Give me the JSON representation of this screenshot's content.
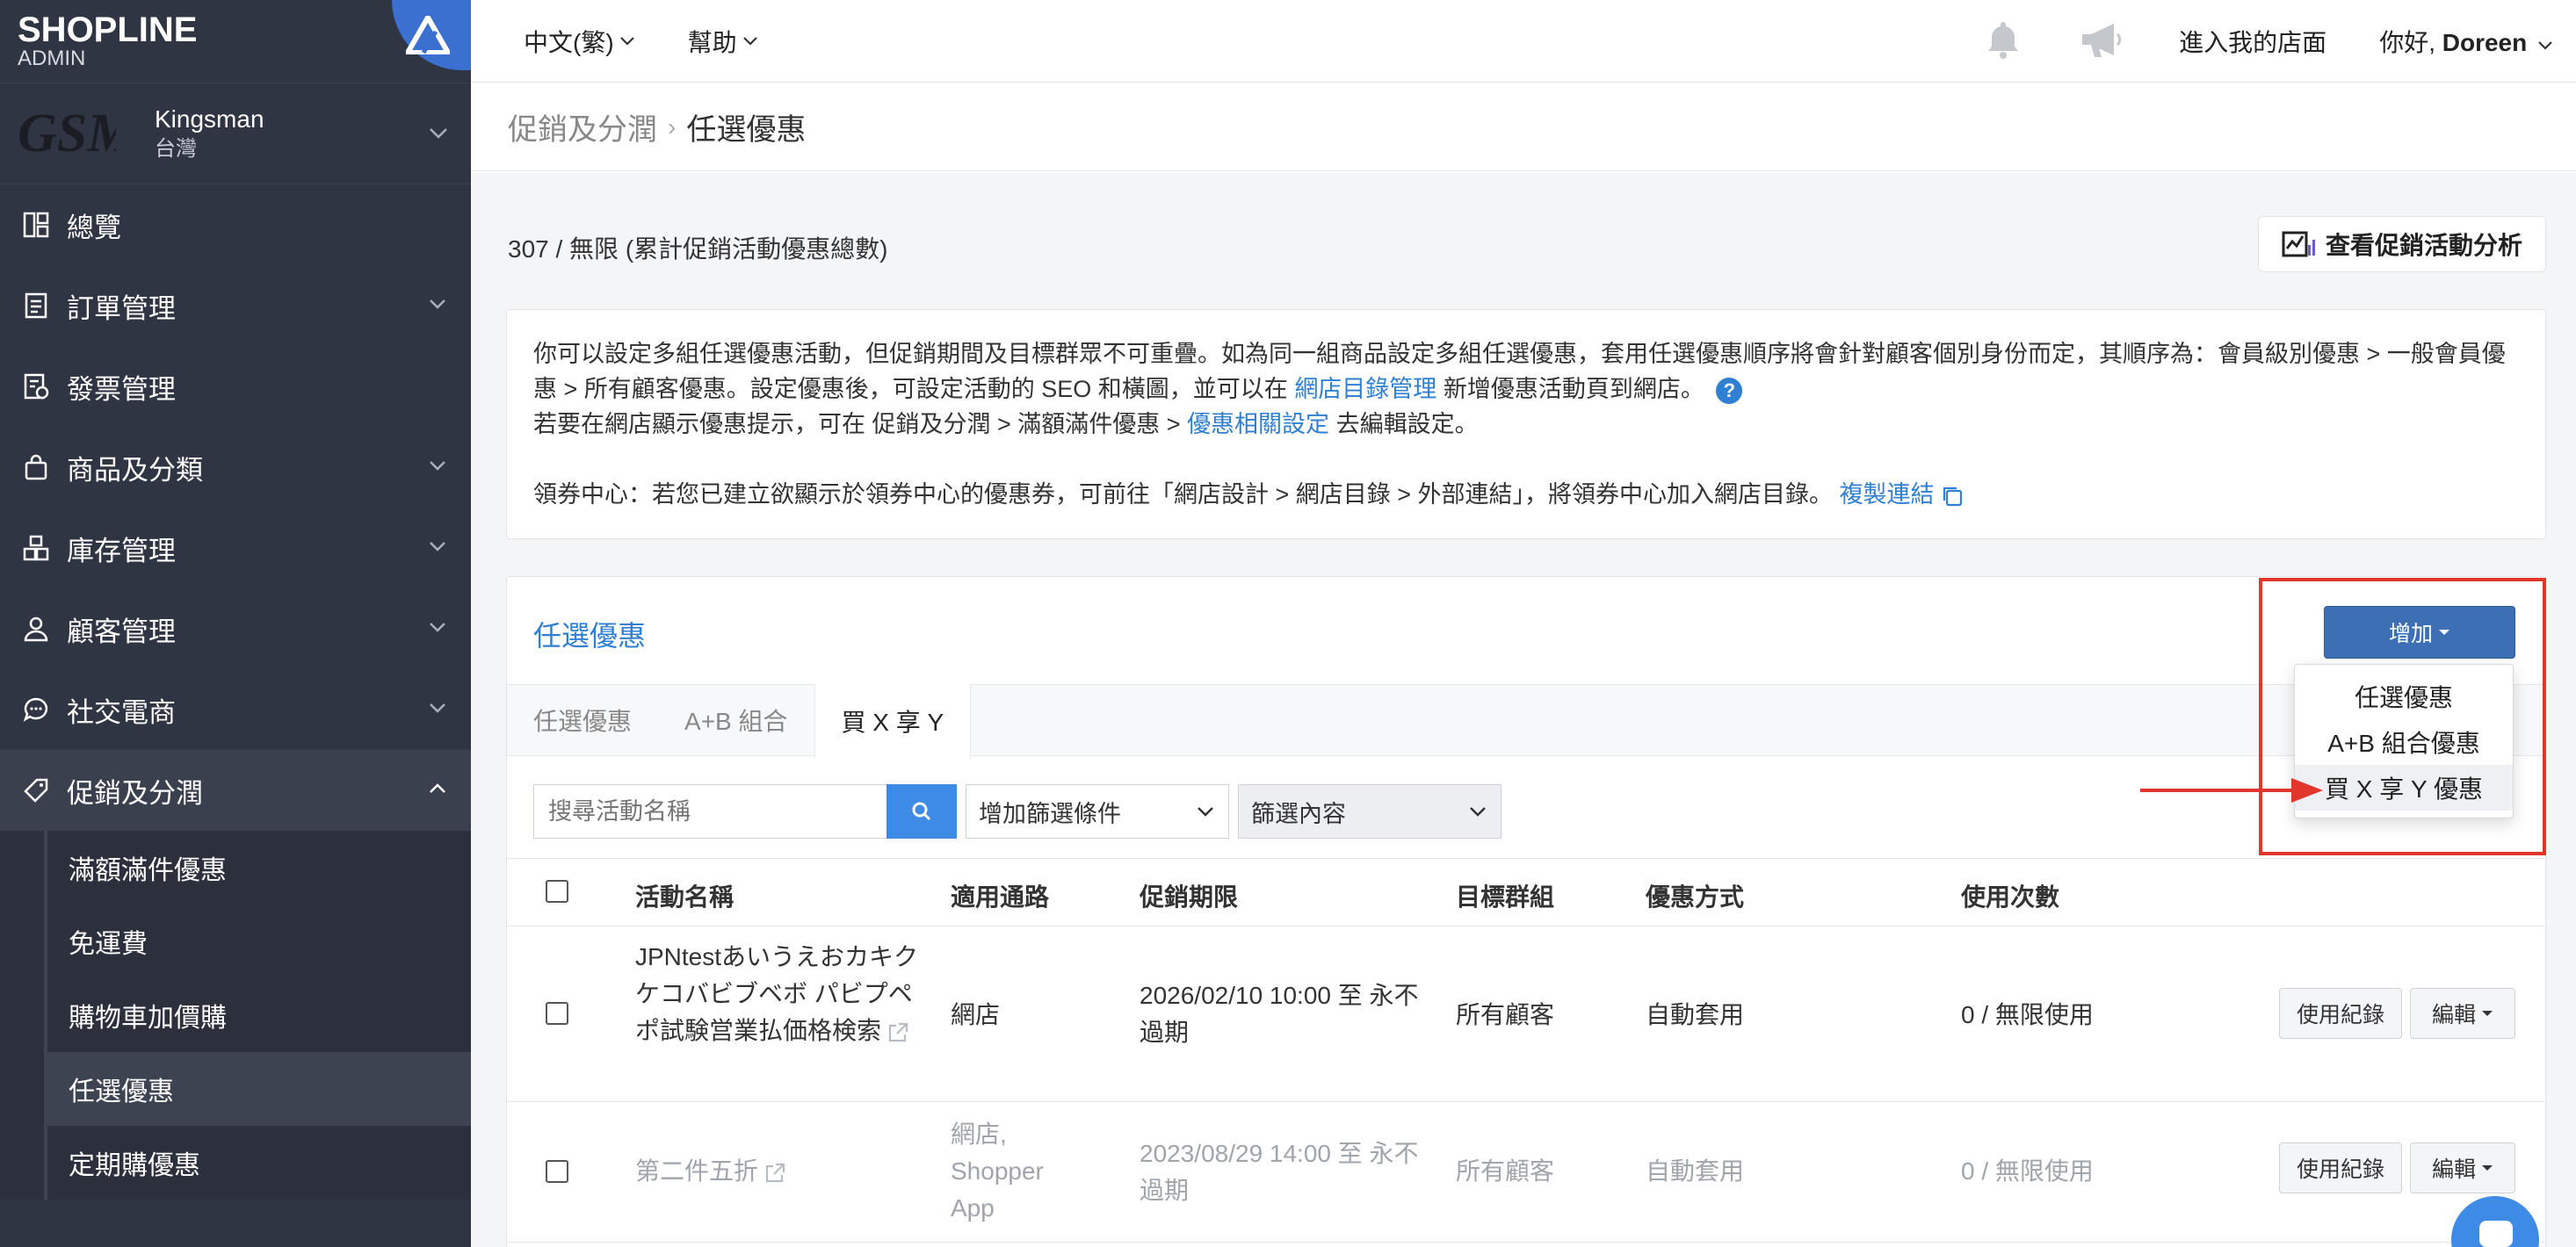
{
  "brand": {
    "logo": "SHOPLINE",
    "sub": "ADMIN"
  },
  "store": {
    "logo_text": "GSM",
    "name": "Kingsman",
    "region": "台灣"
  },
  "sidebar": {
    "items": [
      {
        "label": "總覽",
        "icon": "dashboard-icon"
      },
      {
        "label": "訂單管理",
        "icon": "orders-icon"
      },
      {
        "label": "發票管理",
        "icon": "invoice-icon"
      },
      {
        "label": "商品及分類",
        "icon": "bag-icon"
      },
      {
        "label": "庫存管理",
        "icon": "inventory-icon"
      },
      {
        "label": "顧客管理",
        "icon": "user-icon"
      },
      {
        "label": "社交電商",
        "icon": "chat-icon"
      },
      {
        "label": "促銷及分潤",
        "icon": "tag-icon"
      }
    ],
    "sub_items": [
      "滿額滿件優惠",
      "免運費",
      "購物車加價購",
      "任選優惠",
      "定期購優惠"
    ]
  },
  "topbar": {
    "language": "中文(繁)",
    "help": "幫助",
    "enter_store": "進入我的店面",
    "greeting": "你好,",
    "user": "Doreen"
  },
  "breadcrumb": {
    "parent": "促銷及分潤",
    "current": "任選優惠"
  },
  "count_text": "307 / 無限 (累計促銷活動優惠總數)",
  "analytics_button": "查看促銷活動分析",
  "notice": {
    "line1": "你可以設定多組任選優惠活動，但促銷期間及目標群眾不可重疊。如為同一組商品設定多組任選優惠，套用任選優惠順序將會針對顧客個別身份而定，其順序為：會員級別優惠 > 一般會員優惠 > 所有顧客優惠。設定優惠後，可設定活動的 SEO 和橫圖，並可以在",
    "link1": "網店目錄管理",
    "line1_end": "新增優惠活動頁到網店。",
    "line2_start": "若要在網店顯示優惠提示，可在 促銷及分潤 > 滿額滿件優惠 >",
    "link2": "優惠相關設定",
    "line2_end": "去編輯設定。",
    "line3": "領券中心：若您已建立欲顯示於領券中心的優惠券，可前往「網店設計 > 網店目錄 > 外部連結」，將領券中心加入網店目錄。",
    "link3": "複製連結"
  },
  "panel": {
    "title": "任選優惠",
    "add_button": "增加",
    "add_menu": [
      "任選優惠",
      "A+B 組合優惠",
      "買 X 享 Y 優惠"
    ],
    "tabs": [
      "任選優惠",
      "A+B 組合",
      "買 X 享 Y"
    ],
    "search_placeholder": "搜尋活動名稱",
    "filter_condition": "增加篩選條件",
    "filter_content": "篩選內容"
  },
  "table": {
    "headers": [
      "活動名稱",
      "適用通路",
      "促銷期限",
      "目標群組",
      "優惠方式",
      "使用次數"
    ],
    "rows": [
      {
        "name": "JPNtestあいうえおカキクケコバビブベボ パビプペポ試験営業払価格検索",
        "channel": "網店",
        "period": "2026/02/10 10:00 至 永不過期",
        "target": "所有顧客",
        "method": "自動套用",
        "usage": "0 / 無限使用"
      },
      {
        "name": "第二件五折",
        "channel": "網店, Shopper App",
        "period": "2023/08/29 14:00 至 永不過期",
        "target": "所有顧客",
        "method": "自動套用",
        "usage": "0 / 無限使用"
      }
    ],
    "btn_log": "使用紀錄",
    "btn_edit": "編輯"
  },
  "colors": {
    "sidebar": "#2f3542",
    "accent": "#2f7fd2",
    "highlight": "#e0362b",
    "primary_button": "#3c6fb3"
  }
}
